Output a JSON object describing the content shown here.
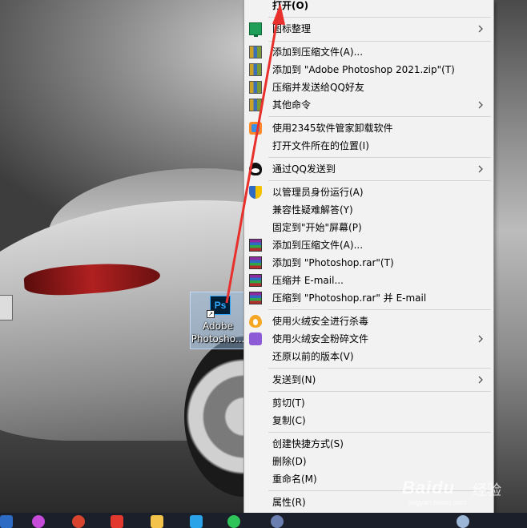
{
  "context_menu": {
    "items": [
      {
        "label": "打开(O)",
        "icon": "",
        "submenu": false,
        "bold": true
      },
      {
        "label": "图标整理",
        "icon": "monitor-icon",
        "submenu": true
      },
      {
        "label": "添加到压缩文件(A)...",
        "icon": "winzip-icon",
        "submenu": false
      },
      {
        "label": "添加到 \"Adobe Photoshop 2021.zip\"(T)",
        "icon": "winzip-icon",
        "submenu": false
      },
      {
        "label": "压缩并发送给QQ好友",
        "icon": "winzip-icon",
        "submenu": false
      },
      {
        "label": "其他命令",
        "icon": "winzip-icon",
        "submenu": true
      },
      {
        "label": "使用2345软件管家卸载软件",
        "icon": "uninstall-icon",
        "submenu": false
      },
      {
        "label": "打开文件所在的位置(I)",
        "icon": "",
        "submenu": false
      },
      {
        "label": "通过QQ发送到",
        "icon": "qq-icon",
        "submenu": true
      },
      {
        "label": "以管理员身份运行(A)",
        "icon": "uac-shield-icon",
        "submenu": false
      },
      {
        "label": "兼容性疑难解答(Y)",
        "icon": "",
        "submenu": false
      },
      {
        "label": "固定到\"开始\"屏幕(P)",
        "icon": "",
        "submenu": false
      },
      {
        "label": "添加到压缩文件(A)...",
        "icon": "winrar-icon",
        "submenu": false
      },
      {
        "label": "添加到 \"Photoshop.rar\"(T)",
        "icon": "winrar-icon",
        "submenu": false
      },
      {
        "label": "压缩并 E-mail...",
        "icon": "winrar-icon",
        "submenu": false
      },
      {
        "label": "压缩到 \"Photoshop.rar\" 并 E-mail",
        "icon": "winrar-icon",
        "submenu": false
      },
      {
        "label": "使用火绒安全进行杀毒",
        "icon": "huorong-icon",
        "submenu": false
      },
      {
        "label": "使用火绒安全粉碎文件",
        "icon": "shredder-icon",
        "submenu": true
      },
      {
        "label": "还原以前的版本(V)",
        "icon": "",
        "submenu": false
      },
      {
        "label": "发送到(N)",
        "icon": "",
        "submenu": true
      },
      {
        "label": "剪切(T)",
        "icon": "",
        "submenu": false
      },
      {
        "label": "复制(C)",
        "icon": "",
        "submenu": false
      },
      {
        "label": "创建快捷方式(S)",
        "icon": "",
        "submenu": false
      },
      {
        "label": "删除(D)",
        "icon": "",
        "submenu": false
      },
      {
        "label": "重命名(M)",
        "icon": "",
        "submenu": false
      },
      {
        "label": "属性(R)",
        "icon": "",
        "submenu": false
      }
    ]
  },
  "desktop_icon": {
    "app_badge": "Ps",
    "label_line1": "Adobe",
    "label_line2": "Photosho..."
  },
  "watermark": {
    "logo": "Baidu",
    "suffix": "经验",
    "url": "jingyan.baidu.com"
  },
  "annotation_color": "#e8302c",
  "accent_colors": {
    "menu_bg": "#f2f2f2",
    "taskbar": "#1b1f2a"
  }
}
